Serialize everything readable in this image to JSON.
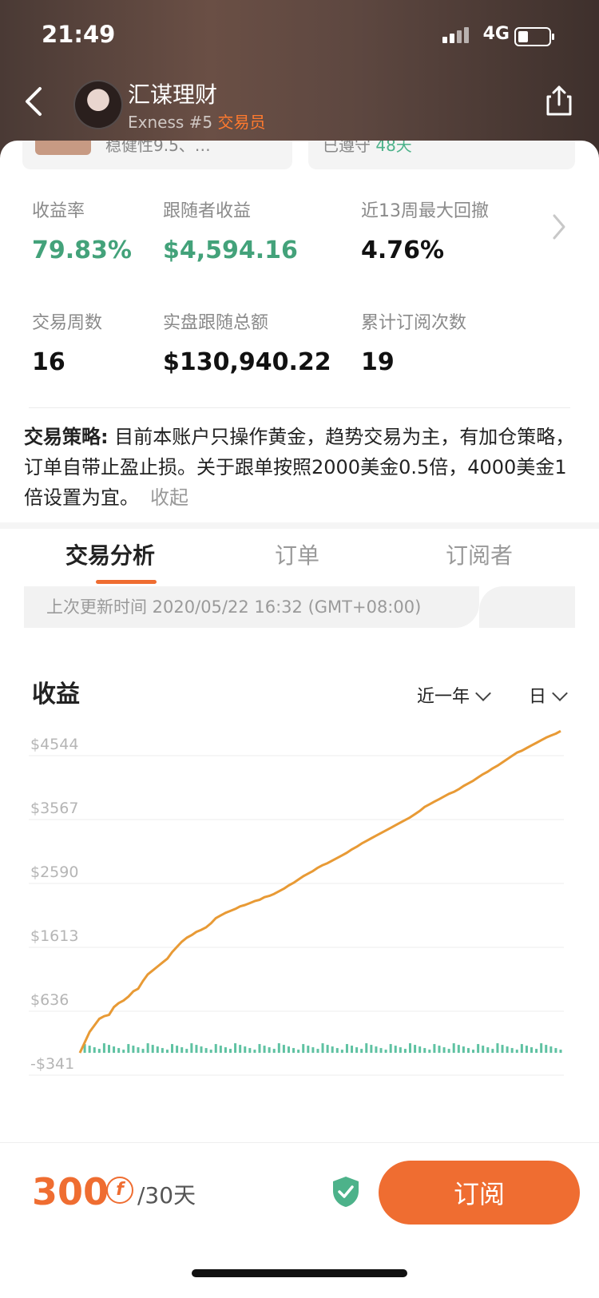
{
  "status_bar": {
    "time": "21:49",
    "network": "4G"
  },
  "nav": {
    "title": "汇谋理财",
    "subtitle_prefix": "Exness #5 ",
    "subtitle_role": "交易员"
  },
  "peek_cards": {
    "left_text": "稳健性9.5、…",
    "right_text": "已遵守 ",
    "right_value": "48天"
  },
  "stats": [
    {
      "label": "收益率",
      "value": "79.83%",
      "color": "#43a27a"
    },
    {
      "label": "跟随者收益",
      "value": "$4,594.16",
      "color": "#43a27a"
    },
    {
      "label": "近13周最大回撤",
      "value": "4.76%",
      "color": "#111111"
    },
    {
      "label": "交易周数",
      "value": "16",
      "color": "#111111"
    },
    {
      "label": "实盘跟随总额",
      "value": "$130,940.22",
      "color": "#111111"
    },
    {
      "label": "累计订阅次数",
      "value": "19",
      "color": "#111111"
    }
  ],
  "strategy": {
    "label": "交易策略:",
    "text": " 目前本账户只操作黄金，趋势交易为主，有加仓策略，订单自带止盈止损。关于跟单按照2000美金0.5倍，4000美金1倍设置为宜。",
    "collapse": "收起"
  },
  "tabs": [
    "交易分析",
    "订单",
    "订阅者"
  ],
  "updated": "上次更新时间 2020/05/22 16:32 (GMT+08:00)",
  "chart_section": {
    "title": "收益",
    "range": "近一年",
    "period": "日"
  },
  "chart_data": {
    "type": "line",
    "title": "",
    "y_ticks": [
      "$4544",
      "$3567",
      "$2590",
      "$1613",
      "$636",
      "-$341"
    ],
    "ylim": [
      -341,
      4544
    ],
    "line_color": "#e89a35",
    "bar_color": "#5fc2a2",
    "series": [
      {
        "values": [
          0,
          160,
          320,
          420,
          520,
          560,
          580,
          700,
          760,
          800,
          860,
          940,
          980,
          1100,
          1200,
          1260,
          1320,
          1380,
          1440,
          1540,
          1620,
          1700,
          1760,
          1800,
          1850,
          1880,
          1920,
          1980,
          2060,
          2100,
          2140,
          2170,
          2200,
          2240,
          2260,
          2290,
          2320,
          2340,
          2380,
          2400,
          2430,
          2470,
          2510,
          2560,
          2600,
          2650,
          2700,
          2740,
          2780,
          2830,
          2870,
          2900,
          2940,
          2980,
          3020,
          3060,
          3110,
          3150,
          3200,
          3240,
          3280,
          3320,
          3360,
          3400,
          3440,
          3480,
          3520,
          3560,
          3600,
          3650,
          3700,
          3760,
          3800,
          3840,
          3880,
          3920,
          3960,
          3990,
          4030,
          4080,
          4120,
          4160,
          4210,
          4260,
          4300,
          4350,
          4390,
          4440,
          4490,
          4540,
          4590,
          4620,
          4660,
          4700,
          4740,
          4780,
          4820,
          4850,
          4880,
          4920
        ]
      }
    ]
  },
  "bottom": {
    "price": "300",
    "coin": "f",
    "per": "/30天",
    "subscribe": "订阅"
  }
}
